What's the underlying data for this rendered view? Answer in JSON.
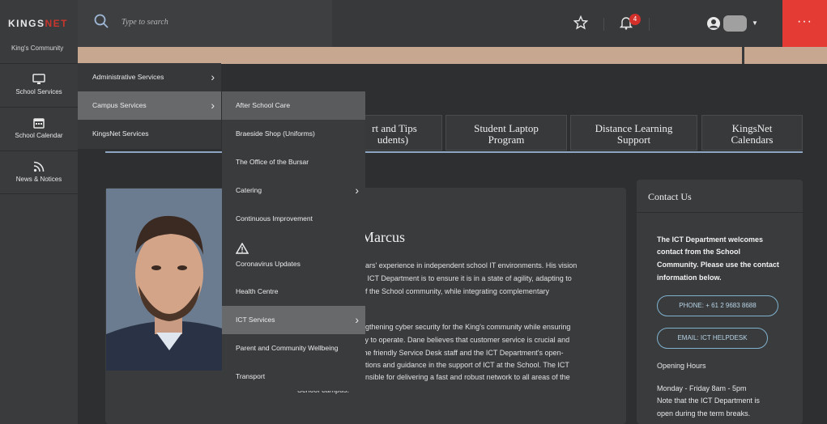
{
  "brand": {
    "logo_a": "KINGS",
    "logo_b": "NET",
    "community": "King's Community"
  },
  "rail": [
    {
      "label": "School Services",
      "icon": "monitor-icon"
    },
    {
      "label": "School Calendar",
      "icon": "calendar-icon"
    },
    {
      "label": "News & Notices",
      "icon": "rss-icon"
    }
  ],
  "search": {
    "placeholder": "Type to search"
  },
  "notifications": {
    "count": "4"
  },
  "menu_button": "···",
  "tabs": [
    {
      "l1": "rt and Tips",
      "l2": "udents)"
    },
    {
      "l1": "Student Laptop",
      "l2": "Program"
    },
    {
      "l1": "Distance Learning",
      "l2": "Support"
    },
    {
      "l1": "KingsNet",
      "l2": "Calendars"
    }
  ],
  "profile": {
    "name": "Marcus",
    "bio": [
      "ears'  experience in independent school IT environments. His vision",
      "e ICT Department is to ensure it is in a state of agility, adapting to",
      "of the School community, while integrating complementary",
      "ngthening cyber security for the King's community while ensuring",
      "sy to operate. Dane believes that customer service is crucial and",
      "the friendly Service Desk staff and the ICT Department's open-",
      "ations and guidance in the support of ICT at the School. The ICT",
      "onsible for delivering a fast and robust network to all areas of the",
      "School campus."
    ]
  },
  "contact": {
    "title": "Contact Us",
    "intro": [
      "The ICT Department welcomes",
      "contact from the School",
      "Community. Please use the contact",
      "information below."
    ],
    "phone_btn": "PHONE: + 61 2 9683 8688",
    "email_btn": "EMAIL: ICT HELPDESK",
    "hours_title": "Opening Hours",
    "hours": [
      "Monday - Friday 8am - 5pm",
      "Note that the ICT Department is",
      "open during the term breaks."
    ]
  },
  "menu1": [
    {
      "label": "Administrative Services",
      "has_sub": true
    },
    {
      "label": "Campus Services",
      "has_sub": true,
      "active": true
    },
    {
      "label": "KingsNet Services",
      "has_sub": false
    }
  ],
  "menu2": [
    {
      "label": "After School Care"
    },
    {
      "label": "Braeside Shop (Uniforms)"
    },
    {
      "label": "The Office of the Bursar"
    },
    {
      "label": "Catering",
      "has_sub": true
    },
    {
      "label": "Continuous Improvement"
    },
    {
      "label": "Coronavirus Updates",
      "icon": "warning-icon"
    },
    {
      "label": "Health Centre"
    },
    {
      "label": "ICT Services",
      "has_sub": true
    },
    {
      "label": "Parent and Community Wellbeing"
    },
    {
      "label": "Transport"
    }
  ],
  "colors": {
    "accent_red": "#e43b34",
    "link_blue": "#8fa6c3",
    "badge_red": "#d3302b"
  }
}
